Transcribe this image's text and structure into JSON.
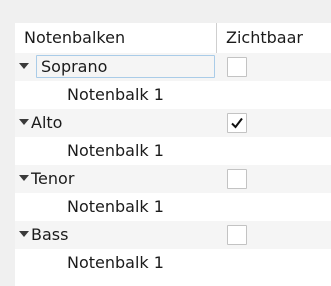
{
  "table": {
    "columns": {
      "name": "Notenbalken",
      "visible": "Zichtbaar"
    },
    "groups": [
      {
        "name": "Soprano",
        "expanded": true,
        "checked": false,
        "focused": true,
        "staves": [
          {
            "name": "Notenbalk 1"
          }
        ]
      },
      {
        "name": "Alto",
        "expanded": true,
        "checked": true,
        "focused": false,
        "staves": [
          {
            "name": "Notenbalk 1"
          }
        ]
      },
      {
        "name": "Tenor",
        "expanded": true,
        "checked": false,
        "focused": false,
        "staves": [
          {
            "name": "Notenbalk 1"
          }
        ]
      },
      {
        "name": "Bass",
        "expanded": true,
        "checked": false,
        "focused": false,
        "staves": [
          {
            "name": "Notenbalk 1"
          }
        ]
      }
    ]
  }
}
